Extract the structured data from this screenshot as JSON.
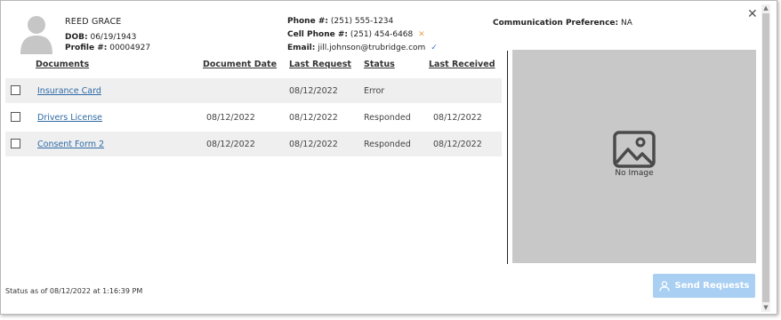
{
  "patient": {
    "name": "REED GRACE",
    "dob_label": "DOB:",
    "dob": "06/19/1943",
    "profile_label": "Profile #:",
    "profile": "00004927"
  },
  "contact": {
    "phone_label": "Phone #:",
    "phone": "(251) 555-1234",
    "cell_label": "Cell Phone #:",
    "cell": "(251) 454-6468",
    "email_label": "Email:",
    "email": "jill.johnson@trubridge.com"
  },
  "preference": {
    "label": "Communication Preference:",
    "value": "NA"
  },
  "table": {
    "headers": {
      "documents": "Documents",
      "document_date": "Document Date",
      "last_request": "Last Request",
      "status": "Status",
      "last_received": "Last Received"
    },
    "rows": [
      {
        "document": "Insurance Card",
        "document_date": "",
        "last_request": "08/12/2022",
        "status": "Error",
        "last_received": ""
      },
      {
        "document": "Drivers License",
        "document_date": "08/12/2022",
        "last_request": "08/12/2022",
        "status": "Responded",
        "last_received": "08/12/2022"
      },
      {
        "document": "Consent Form 2",
        "document_date": "08/12/2022",
        "last_request": "08/12/2022",
        "status": "Responded",
        "last_received": "08/12/2022"
      }
    ]
  },
  "preview": {
    "no_image_text": "No Image"
  },
  "footer": {
    "status_text": "Status as of 08/12/2022 at 1:16:39 PM",
    "send_label": "Send Requests"
  },
  "icons": {
    "close": "close-icon",
    "cell_invalid": "x-icon",
    "email_verified": "checkmark-icon",
    "avatar": "user-avatar-icon",
    "image_placeholder": "image-icon",
    "send": "user-icon"
  },
  "colors": {
    "link": "#2d6aa6",
    "send_button": "#a9cff2",
    "preview_bg": "#c8c8c8",
    "row_shade": "#efefef",
    "warning_x": "#e8a052",
    "verified_check": "#3b76c4"
  }
}
